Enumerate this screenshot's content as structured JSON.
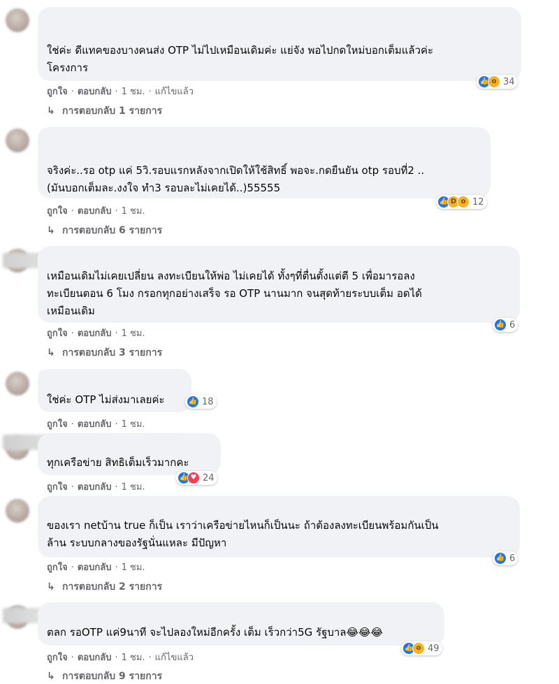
{
  "comments": [
    {
      "lines": [
        "ใช่ค่ะ ดีแทคของบางคนส่ง OTP ไม่ไปเหมือนเดิมค่ะ แย่จัง พอไปกดใหม่บอกเต็มแล้วค่ะ",
        "โครงการ"
      ],
      "meta": {
        "like": "ถูกใจ",
        "reply": "ตอบกลับ",
        "time": "1 ชม.",
        "edited": "แก้ไขแล้ว"
      },
      "reactions": {
        "icons": [
          "like-icon",
          "wow-icon"
        ],
        "count": "34"
      },
      "replies": "การตอบกลับ 1 รายการ"
    },
    {
      "lines": [
        "จริงค่ะ..รอ otp แค่ 5วิ.รอบแรกหลังจากเปิดให้ใช้สิทธิ์ พอจะ.กดยืนยัน otp รอบที่2 ..",
        "(มันบอกเต็มละ.งงใจ ทำ3 รอบละไม่เคยได้..)55555"
      ],
      "meta": {
        "like": "ถูกใจ",
        "reply": "ตอบกลับ",
        "time": "1 ชม."
      },
      "reactions": {
        "icons": [
          "like-icon",
          "haha-icon",
          "wow-icon"
        ],
        "count": "12"
      },
      "replies": "การตอบกลับ 6 รายการ"
    },
    {
      "lines": [
        "เหมือนเดิมไม่เคยเปลี่ยน ลงทะเบียนให้พ่อ ไม่เคยได้ ทั้งๆที่ตื่นตั้งแต่ตี 5 เพื่อมารอลง",
        "ทะเบียนตอน 6 โมง กรอกทุกอย่างเสร็จ รอ OTP นานมาก จนสุดท้ายระบบเต็ม อดได้",
        "เหมือนเดิม"
      ],
      "meta": {
        "like": "ถูกใจ",
        "reply": "ตอบกลับ",
        "time": "1 ชม."
      },
      "reactions": {
        "icons": [
          "like-icon"
        ],
        "count": "6"
      },
      "replies": "การตอบกลับ 3 รายการ"
    },
    {
      "lines": [
        "ใช่ค่ะ OTP ไม่ส่งมาเลยค่ะ"
      ],
      "meta": {
        "like": "ถูกใจ",
        "reply": "ตอบกลับ",
        "time": "1 ชม."
      },
      "reactions": {
        "icons": [
          "like-icon"
        ],
        "count": "18"
      }
    },
    {
      "lines": [
        "ทุกเครือข่าย สิทธิเต็มเร็วมากคะ"
      ],
      "meta": {
        "like": "ถูกใจ",
        "reply": "ตอบกลับ",
        "time": "1 ชม."
      },
      "reactions": {
        "icons": [
          "like-icon",
          "love-icon"
        ],
        "count": "24"
      }
    },
    {
      "lines": [
        "ของเรา netบ้าน true ก็เป็น เราว่าเครือข่ายไหนก็เป็นนะ ถ้าต้องลงทะเบียนพร้อมกันเป็น",
        "ล้าน ระบบกลางของรัฐนั่นแหละ มีปัญหา"
      ],
      "meta": {
        "like": "ถูกใจ",
        "reply": "ตอบกลับ",
        "time": "1 ชม."
      },
      "reactions": {
        "icons": [
          "like-icon"
        ],
        "count": "6"
      },
      "replies": "การตอบกลับ 2 รายการ"
    },
    {
      "lines": [
        "ตลก รอOTP แค่9นาที จะไปลองใหม่อีกครั้ง เต็ม เร็วกว่า5G รัฐบาล😂😂😂"
      ],
      "meta": {
        "like": "ถูกใจ",
        "reply": "ตอบกลับ",
        "time": "1 ชม.",
        "edited": "แก้ไขแล้ว"
      },
      "reactions": {
        "icons": [
          "like-icon",
          "wow-icon"
        ],
        "count": "49"
      },
      "replies": "การตอบกลับ 9 รายการ"
    }
  ],
  "colors": {
    "bubble": "#f0f2f5",
    "meta": "#65676b",
    "like": "#1877f2",
    "love": "#f33e58",
    "wow": "#f7b125"
  }
}
